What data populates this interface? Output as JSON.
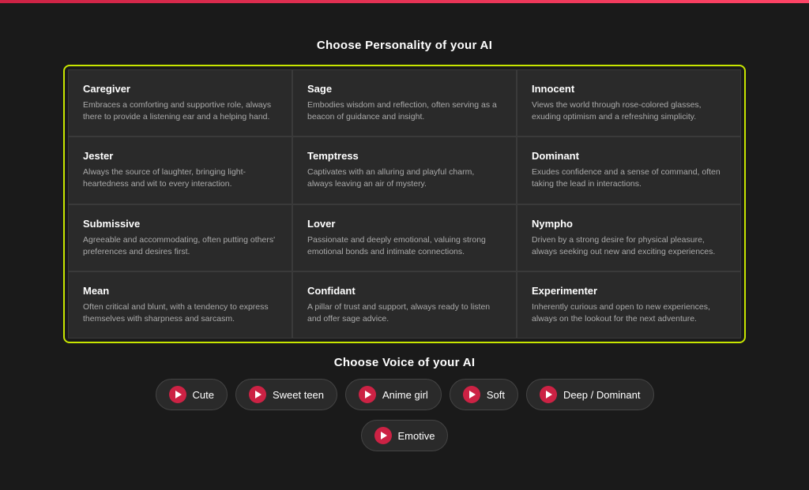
{
  "personality_section": {
    "title": "Choose Personality of your AI",
    "cards": [
      {
        "title": "Caregiver",
        "desc": "Embraces a comforting and supportive role, always there to provide a listening ear and a helping hand."
      },
      {
        "title": "Sage",
        "desc": "Embodies wisdom and reflection, often serving as a beacon of guidance and insight."
      },
      {
        "title": "Innocent",
        "desc": "Views the world through rose-colored glasses, exuding optimism and a refreshing simplicity."
      },
      {
        "title": "Jester",
        "desc": "Always the source of laughter, bringing light-heartedness and wit to every interaction."
      },
      {
        "title": "Temptress",
        "desc": "Captivates with an alluring and playful charm, always leaving an air of mystery."
      },
      {
        "title": "Dominant",
        "desc": "Exudes confidence and a sense of command, often taking the lead in interactions."
      },
      {
        "title": "Submissive",
        "desc": "Agreeable and accommodating, often putting others' preferences and desires first."
      },
      {
        "title": "Lover",
        "desc": "Passionate and deeply emotional, valuing strong emotional bonds and intimate connections."
      },
      {
        "title": "Nympho",
        "desc": "Driven by a strong desire for physical pleasure, always seeking out new and exciting experiences."
      },
      {
        "title": "Mean",
        "desc": "Often critical and blunt, with a tendency to express themselves with sharpness and sarcasm."
      },
      {
        "title": "Confidant",
        "desc": "A pillar of trust and support, always ready to listen and offer sage advice."
      },
      {
        "title": "Experimenter",
        "desc": "Inherently curious and open to new experiences, always on the lookout for the next adventure."
      }
    ]
  },
  "voice_section": {
    "title": "Choose Voice of your AI",
    "voices_row1": [
      {
        "label": "Cute"
      },
      {
        "label": "Sweet teen"
      },
      {
        "label": "Anime girl"
      },
      {
        "label": "Soft"
      },
      {
        "label": "Deep / Dominant"
      }
    ],
    "voices_row2": [
      {
        "label": "Emotive"
      }
    ]
  }
}
